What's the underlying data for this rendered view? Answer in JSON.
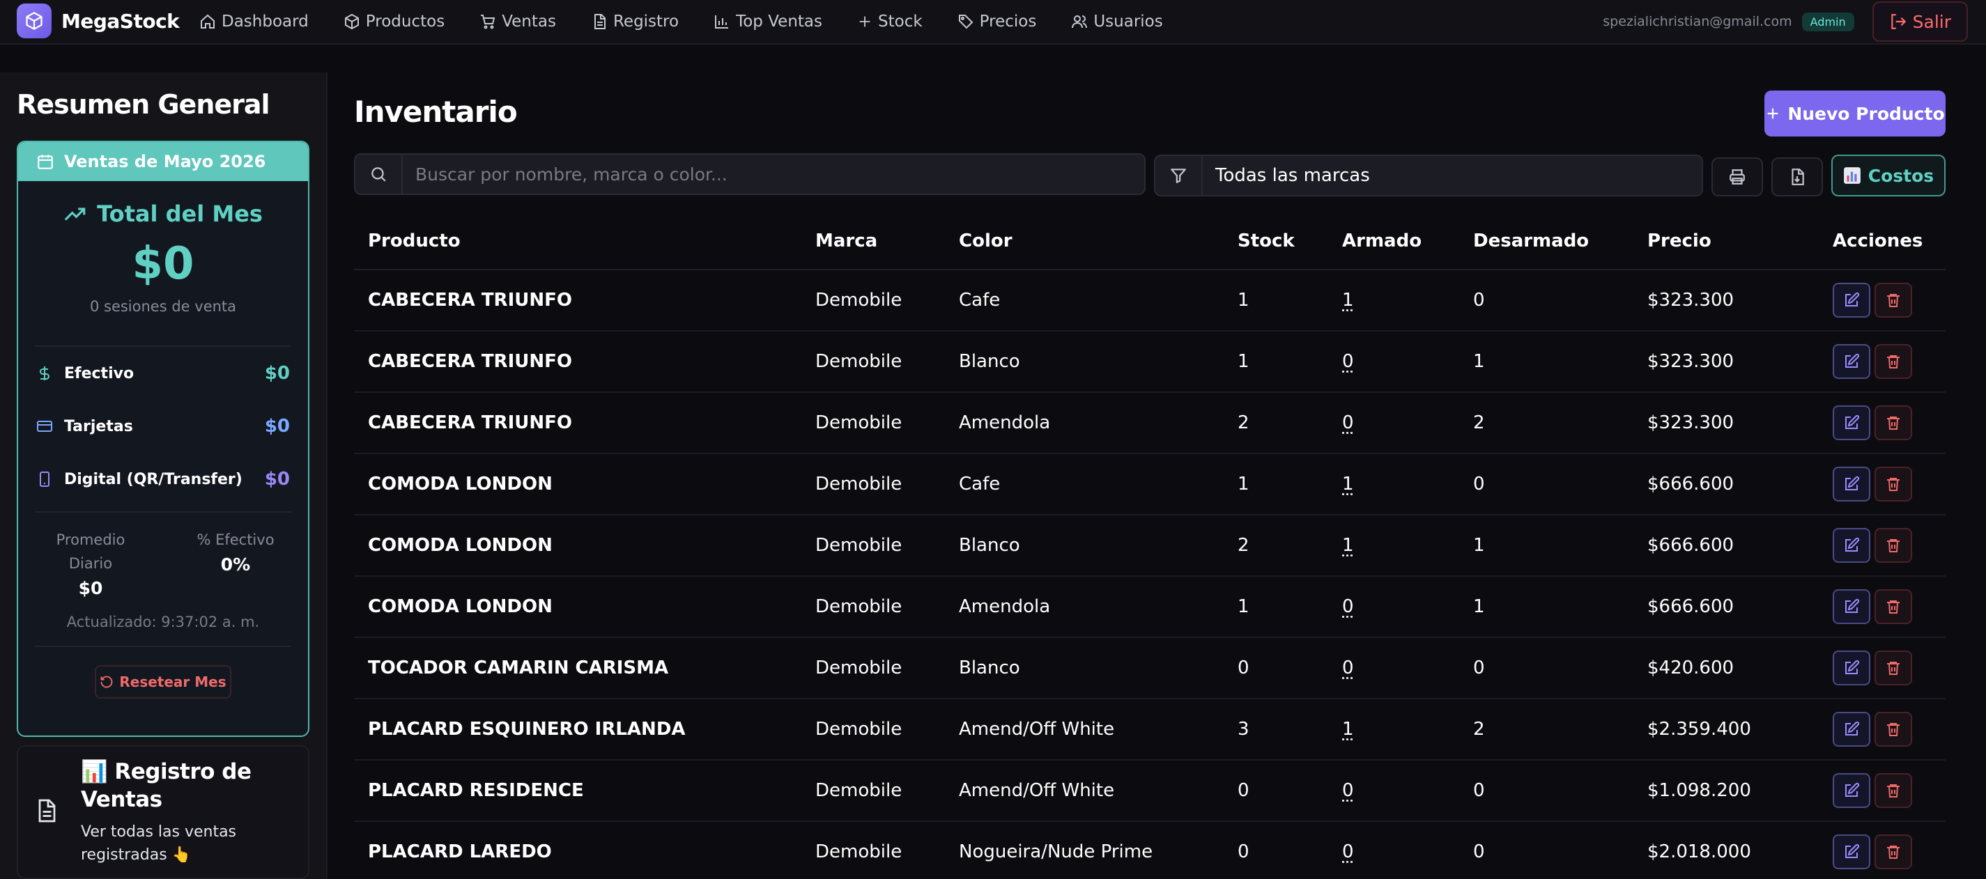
{
  "nav": {
    "brand": "MegaStock",
    "items": [
      {
        "label": "Dashboard",
        "icon": "home-icon"
      },
      {
        "label": "Productos",
        "icon": "box-icon"
      },
      {
        "label": "Ventas",
        "icon": "cart-icon"
      },
      {
        "label": "Registro",
        "icon": "document-icon"
      },
      {
        "label": "Top Ventas",
        "icon": "bar-chart-icon"
      },
      {
        "label": "Stock",
        "icon": "plus-icon"
      },
      {
        "label": "Precios",
        "icon": "tag-icon"
      },
      {
        "label": "Usuarios",
        "icon": "users-icon"
      }
    ],
    "email": "spezialichristian@gmail.com",
    "role": "Admin",
    "logout": "Salir"
  },
  "sidebar": {
    "title": "Resumen General",
    "month_header": "Ventas de Mayo 2026",
    "total_title": "Total del Mes",
    "total_value": "$0",
    "sessions": "0 sesiones de venta",
    "payments": [
      {
        "label": "Efectivo",
        "value": "$0",
        "icon": "dollar-icon",
        "color": "#5fd0c3"
      },
      {
        "label": "Tarjetas",
        "value": "$0",
        "icon": "credit-card-icon",
        "color": "#7aa7ff"
      },
      {
        "label": "Digital (QR/Transfer)",
        "value": "$0",
        "icon": "smartphone-icon",
        "color": "#9b87f5"
      }
    ],
    "stat_daily_label": "Promedio Diario",
    "stat_daily_value": "$0",
    "stat_cash_label": "% Efectivo",
    "stat_cash_value": "0%",
    "updated": "Actualizado: 9:37:02 a. m.",
    "reset": "Resetear Mes",
    "registry_title": "📊 Registro de Ventas",
    "registry_sub": "Ver todas las ventas registradas 👆"
  },
  "main": {
    "title": "Inventario",
    "new_product": "Nuevo Producto",
    "search_placeholder": "Buscar por nombre, marca o color...",
    "brand_filter": "Todas las marcas",
    "costs": "Costos",
    "headers": {
      "producto": "Producto",
      "marca": "Marca",
      "color": "Color",
      "stock": "Stock",
      "armado": "Armado",
      "desarmado": "Desarmado",
      "precio": "Precio",
      "acciones": "Acciones"
    },
    "rows": [
      {
        "producto": "CABECERA TRIUNFO",
        "marca": "Demobile",
        "color": "Cafe",
        "stock": "1",
        "armado": "1",
        "desarmado": "0",
        "precio": "$323.300"
      },
      {
        "producto": "CABECERA TRIUNFO",
        "marca": "Demobile",
        "color": "Blanco",
        "stock": "1",
        "armado": "0",
        "desarmado": "1",
        "precio": "$323.300"
      },
      {
        "producto": "CABECERA TRIUNFO",
        "marca": "Demobile",
        "color": "Amendola",
        "stock": "2",
        "armado": "0",
        "desarmado": "2",
        "precio": "$323.300"
      },
      {
        "producto": "COMODA LONDON",
        "marca": "Demobile",
        "color": "Cafe",
        "stock": "1",
        "armado": "1",
        "desarmado": "0",
        "precio": "$666.600"
      },
      {
        "producto": "COMODA LONDON",
        "marca": "Demobile",
        "color": "Blanco",
        "stock": "2",
        "armado": "1",
        "desarmado": "1",
        "precio": "$666.600"
      },
      {
        "producto": "COMODA LONDON",
        "marca": "Demobile",
        "color": "Amendola",
        "stock": "1",
        "armado": "0",
        "desarmado": "1",
        "precio": "$666.600"
      },
      {
        "producto": "TOCADOR CAMARIN CARISMA",
        "marca": "Demobile",
        "color": "Blanco",
        "stock": "0",
        "armado": "0",
        "desarmado": "0",
        "precio": "$420.600"
      },
      {
        "producto": "PLACARD ESQUINERO IRLANDA",
        "marca": "Demobile",
        "color": "Amend/Off White",
        "stock": "3",
        "armado": "1",
        "desarmado": "2",
        "precio": "$2.359.400"
      },
      {
        "producto": "PLACARD RESIDENCE",
        "marca": "Demobile",
        "color": "Amend/Off White",
        "stock": "0",
        "armado": "0",
        "desarmado": "0",
        "precio": "$1.098.200"
      },
      {
        "producto": "PLACARD LAREDO",
        "marca": "Demobile",
        "color": "Nogueira/Nude Prime",
        "stock": "0",
        "armado": "0",
        "desarmado": "0",
        "precio": "$2.018.000"
      }
    ]
  },
  "colors": {
    "accent": "#7b68ee",
    "teal": "#5fd0c3",
    "danger": "#ff6b6b",
    "background": "#0c0c10"
  }
}
